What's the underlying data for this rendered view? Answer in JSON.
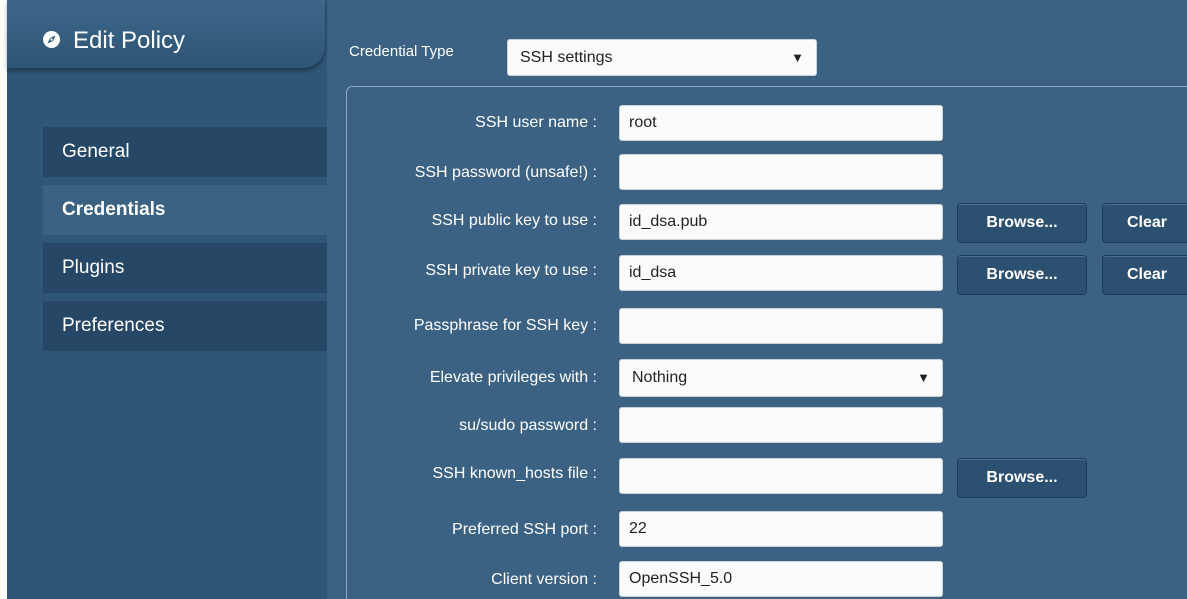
{
  "header": {
    "title": "Edit Policy",
    "icon": "compass-icon"
  },
  "sidebar": {
    "items": [
      {
        "label": "General"
      },
      {
        "label": "Credentials"
      },
      {
        "label": "Plugins"
      },
      {
        "label": "Preferences"
      }
    ],
    "active": "Credentials"
  },
  "credential_type": {
    "label": "Credential Type",
    "value": "SSH settings"
  },
  "form": {
    "ssh_user": {
      "label": "SSH user name :",
      "value": "root"
    },
    "ssh_password": {
      "label": "SSH password (unsafe!) :",
      "value": ""
    },
    "public_key": {
      "label": "SSH public key to use :",
      "value": "id_dsa.pub",
      "browse": "Browse...",
      "clear": "Clear"
    },
    "private_key": {
      "label": "SSH private key to use :",
      "value": "id_dsa",
      "browse": "Browse...",
      "clear": "Clear"
    },
    "passphrase": {
      "label": "Passphrase for SSH key :",
      "value": ""
    },
    "elevate": {
      "label": "Elevate privileges with :",
      "value": "Nothing"
    },
    "su_password": {
      "label": "su/sudo password :",
      "value": ""
    },
    "known_hosts": {
      "label": "SSH known_hosts file :",
      "value": "",
      "browse": "Browse..."
    },
    "port": {
      "label": "Preferred SSH port :",
      "value": "22"
    },
    "client_version": {
      "label": "Client version :",
      "value": "OpenSSH_5.0"
    }
  },
  "colors": {
    "background": "#3b6283",
    "sidebar": "#2f5677",
    "nav_item": "#264866",
    "button": "#2c5070"
  }
}
